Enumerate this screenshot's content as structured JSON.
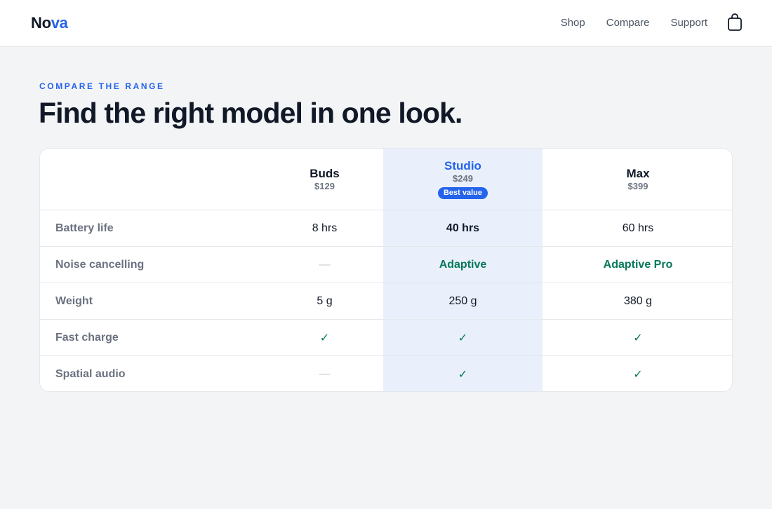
{
  "header": {
    "logo": {
      "part1": "No",
      "part2": "va"
    },
    "nav": [
      "Shop",
      "Compare",
      "Support"
    ]
  },
  "intro": {
    "eyebrow": "COMPARE THE RANGE",
    "headline": "Find the right model in one look."
  },
  "products": [
    {
      "name": "Buds",
      "price": "$129"
    },
    {
      "name": "Studio",
      "price": "$249",
      "badge": "Best value"
    },
    {
      "name": "Max",
      "price": "$399"
    }
  ],
  "rows": [
    {
      "label": "Battery life",
      "values": [
        "8 hrs",
        "40 hrs",
        "60 hrs"
      ]
    },
    {
      "label": "Noise cancelling",
      "values": [
        "—",
        "Adaptive",
        "Adaptive Pro"
      ]
    },
    {
      "label": "Weight",
      "values": [
        "5 g",
        "250 g",
        "380 g"
      ]
    },
    {
      "label": "Fast charge",
      "values": [
        "✓",
        "✓",
        "✓"
      ]
    },
    {
      "label": "Spatial audio",
      "values": [
        "—",
        "✓",
        "✓"
      ]
    }
  ],
  "colors": {
    "accent": "#2563eb",
    "highlight_column": "#e9f0fc",
    "positive": "#047857"
  },
  "icons": {
    "cart": "shopping-bag-icon",
    "check": "check-icon"
  }
}
